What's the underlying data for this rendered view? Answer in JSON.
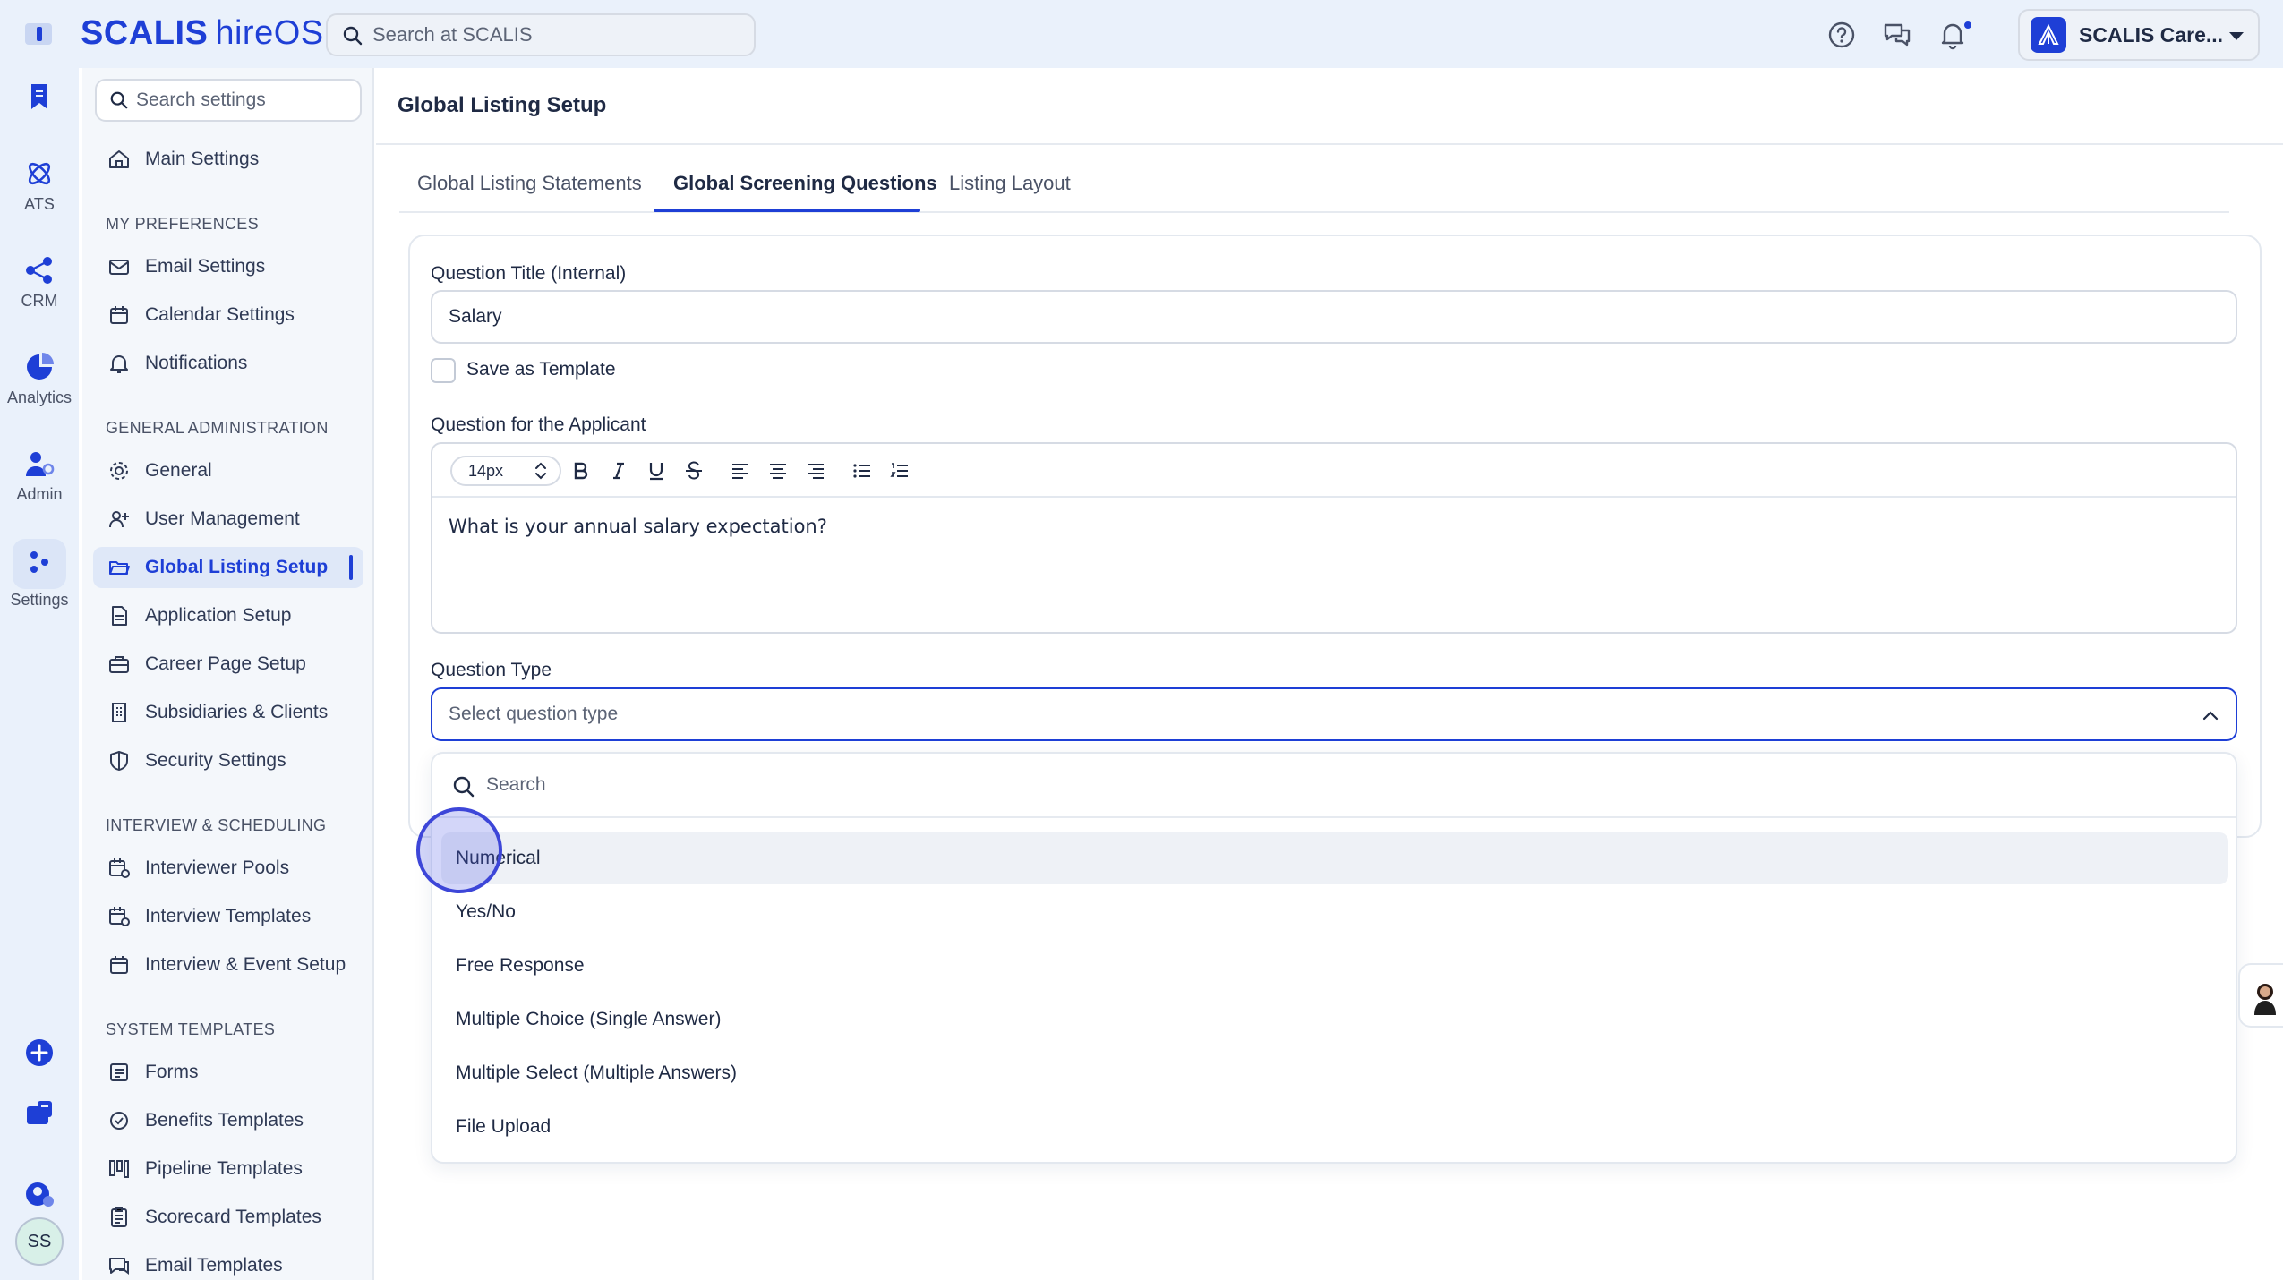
{
  "app": {
    "brand_main": "SCALIS",
    "brand_sub": "hireOS"
  },
  "header": {
    "search_placeholder": "Search at SCALIS",
    "account_name": "SCALIS Care..."
  },
  "rail": {
    "items": [
      {
        "label": ""
      },
      {
        "label": "ATS"
      },
      {
        "label": "CRM"
      },
      {
        "label": "Analytics"
      },
      {
        "label": "Admin"
      },
      {
        "label": "Settings"
      }
    ],
    "avatar_initials": "SS"
  },
  "sidebar": {
    "search_placeholder": "Search settings",
    "main": "Main Settings",
    "sections": {
      "preferences": "MY PREFERENCES",
      "general_admin": "GENERAL ADMINISTRATION",
      "interview": "INTERVIEW & SCHEDULING",
      "templates": "SYSTEM TEMPLATES"
    },
    "items": {
      "email": "Email Settings",
      "calendar": "Calendar Settings",
      "notifications": "Notifications",
      "general": "General",
      "users": "User Management",
      "listing": "Global Listing Setup",
      "application": "Application Setup",
      "career": "Career Page Setup",
      "subsidiaries": "Subsidiaries & Clients",
      "security": "Security Settings",
      "pools": "Interviewer Pools",
      "interview_templates": "Interview Templates",
      "event_setup": "Interview & Event Setup",
      "forms": "Forms",
      "benefits": "Benefits Templates",
      "pipeline": "Pipeline Templates",
      "scorecard": "Scorecard Templates",
      "email_templates": "Email Templates"
    }
  },
  "main": {
    "title": "Global Listing Setup",
    "tabs": [
      "Global Listing Statements",
      "Global Screening Questions",
      "Listing Layout"
    ],
    "form": {
      "title_label": "Question Title (Internal)",
      "title_value": "Salary",
      "save_template_label": "Save as Template",
      "question_label": "Question for the Applicant",
      "font_size": "14px",
      "question_text": "What is your annual salary expectation?",
      "type_label": "Question Type",
      "type_placeholder": "Select question type"
    },
    "dropdown": {
      "search_placeholder": "Search",
      "options": [
        "Numerical",
        "Yes/No",
        "Free Response",
        "Multiple Choice (Single Answer)",
        "Multiple Select (Multiple Answers)",
        "File Upload"
      ]
    }
  }
}
